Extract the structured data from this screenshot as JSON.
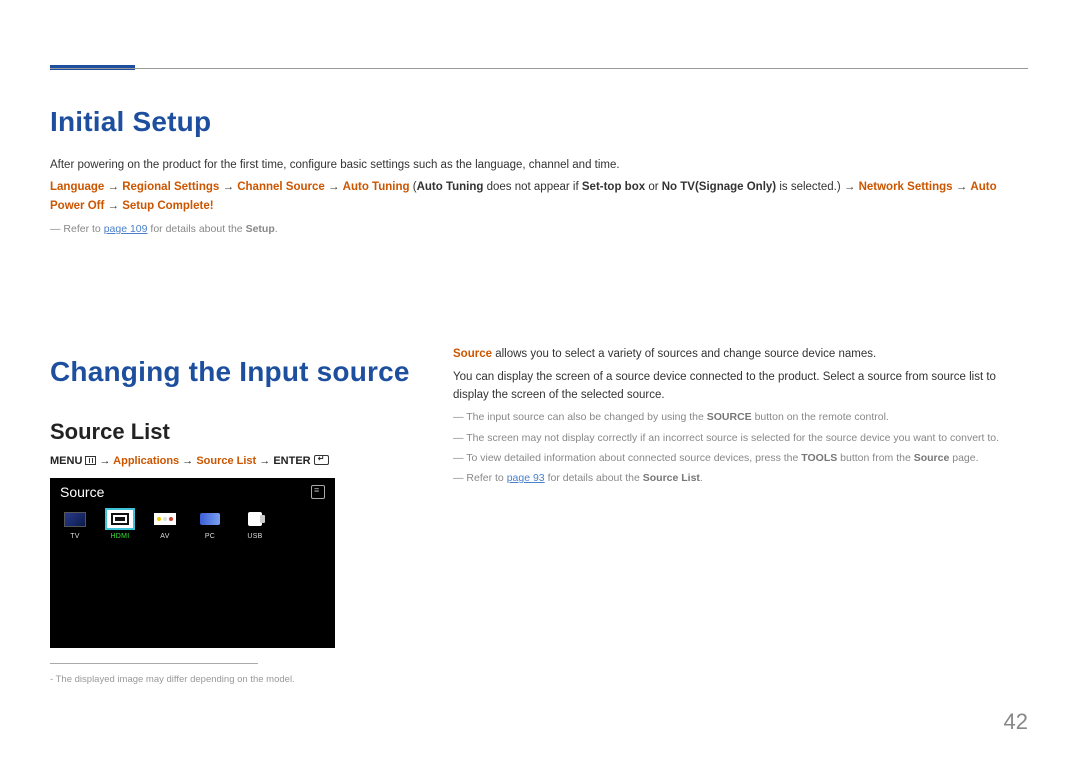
{
  "page_number": "42",
  "headings": {
    "initial_setup": "Initial Setup",
    "changing_source": "Changing the Input source",
    "source_list": "Source List"
  },
  "setup": {
    "intro": "After powering on the product for the first time, configure basic settings such as the language, channel and time.",
    "path": {
      "language": "Language",
      "regional": "Regional Settings",
      "channel_source": "Channel Source",
      "auto_tuning": "Auto Tuning",
      "auto_tuning_paren_open": "(",
      "auto_tuning2": "Auto Tuning",
      "not_appear": " does not appear if ",
      "settop": "Set-top box",
      "or": " or ",
      "notv": "No TV(Signage Only)",
      "is_selected": " is selected.)",
      "network": "Network Settings",
      "autopower": "Auto Power Off",
      "setup_complete": "Setup Complete!",
      "arrow": " → "
    },
    "footnote_prefix": "― Refer to ",
    "footnote_link": "page 109",
    "footnote_mid": " for details about the ",
    "footnote_bold": "Setup",
    "footnote_end": "."
  },
  "menupath": {
    "menu": "MENU ",
    "arrow1": " → ",
    "applications": "Applications",
    "arrow2": " → ",
    "source_list": "Source List",
    "arrow3": " → ",
    "enter": "ENTER "
  },
  "screenshot": {
    "title": "Source",
    "items": {
      "tv": "TV",
      "hdmi": "HDMI",
      "av": "AV",
      "pc": "PC",
      "usb": "USB"
    }
  },
  "img_footnote": "- The displayed image may differ depending on the model.",
  "right": {
    "p1_a": "Source",
    "p1_b": " allows you to select a variety of sources and change source device names.",
    "p2": "You can display the screen of a source device connected to the product. Select a source from source list to display the screen of the selected source.",
    "n1_a": "― The input source can also be changed by using the ",
    "n1_b": "SOURCE",
    "n1_c": " button on the remote control.",
    "n2": "― The screen may not display correctly if an incorrect source is selected for the source device you want to convert to.",
    "n3_a": "― To view detailed information about connected source devices, press the ",
    "n3_b": "TOOLS",
    "n3_c": " button from the ",
    "n3_d": "Source",
    "n3_e": " page.",
    "n4_a": "― Refer to ",
    "n4_link": "page 93",
    "n4_b": " for details about the ",
    "n4_c": "Source List",
    "n4_d": "."
  }
}
